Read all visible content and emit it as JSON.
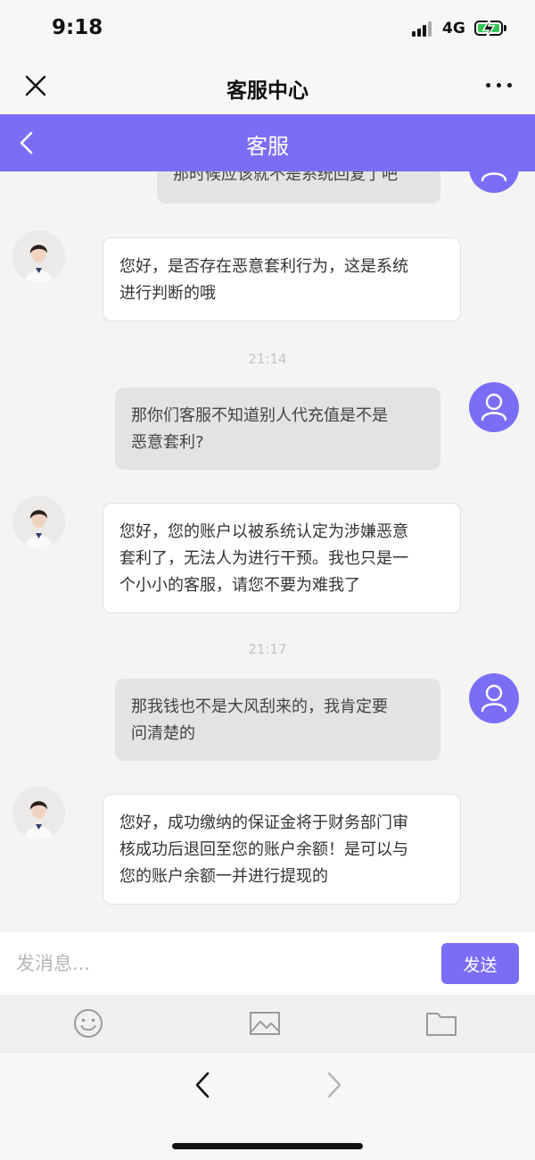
{
  "status_bar": {
    "time": "9:18",
    "network": "4G"
  },
  "nav": {
    "title": "客服中心"
  },
  "header": {
    "title": "客服"
  },
  "chat": {
    "messages": [
      {
        "side": "me",
        "text": "那时候应该就不是系统回复了吧"
      },
      {
        "side": "cs",
        "lines": [
          "您好，是否存在恶意套利行为，这是系统",
          "进行判断的哦"
        ]
      },
      {
        "side": "me",
        "lines": [
          "那你们客服不知道别人代充值是不是",
          "恶意套利?"
        ]
      },
      {
        "side": "cs",
        "lines": [
          "您好，您的账户以被系统认定为涉嫌恶意",
          "套利了，无法人为进行干预。我也只是一",
          "个小小的客服，请您不要为难我了"
        ]
      },
      {
        "side": "me",
        "lines": [
          "那我钱也不是大风刮来的，我肯定要",
          "问清楚的"
        ]
      },
      {
        "side": "cs",
        "lines": [
          "您好，成功缴纳的保证金将于财务部门审",
          "核成功后退回至您的账户余额！是可以与",
          "您的账户余额一并进行提现的"
        ]
      }
    ],
    "timestamps": [
      "21:14",
      "21:17"
    ]
  },
  "input": {
    "placeholder": "发消息...",
    "send_label": "发送"
  },
  "toolbar": {
    "icons": [
      "emoji-icon",
      "image-icon",
      "folder-icon"
    ]
  },
  "browser": {
    "icons": [
      "back-arrow-icon",
      "forward-arrow-icon"
    ]
  },
  "colors": {
    "accent": "#7b6ef6",
    "battery": "#35c759"
  }
}
